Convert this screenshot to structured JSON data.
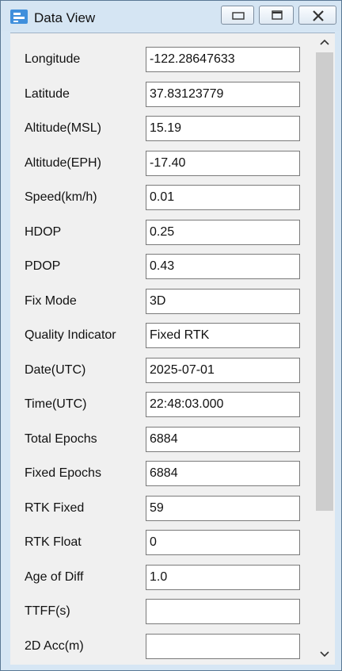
{
  "window": {
    "title": "Data View",
    "buttons": [
      "minimize",
      "restore",
      "close"
    ]
  },
  "rows": [
    {
      "label": "Longitude",
      "value": "-122.28647633"
    },
    {
      "label": "Latitude",
      "value": "37.83123779"
    },
    {
      "label": "Altitude(MSL)",
      "value": "15.19"
    },
    {
      "label": "Altitude(EPH)",
      "value": "-17.40"
    },
    {
      "label": "Speed(km/h)",
      "value": "0.01"
    },
    {
      "label": "HDOP",
      "value": "0.25"
    },
    {
      "label": "PDOP",
      "value": "0.43"
    },
    {
      "label": "Fix Mode",
      "value": "3D"
    },
    {
      "label": "Quality Indicator",
      "value": "Fixed RTK"
    },
    {
      "label": "Date(UTC)",
      "value": "2025-07-01"
    },
    {
      "label": "Time(UTC)",
      "value": "22:48:03.000"
    },
    {
      "label": "Total Epochs",
      "value": "6884"
    },
    {
      "label": "Fixed Epochs",
      "value": "6884"
    },
    {
      "label": "RTK Fixed",
      "value": "59"
    },
    {
      "label": "RTK Float",
      "value": "0"
    },
    {
      "label": "Age of Diff",
      "value": "1.0"
    },
    {
      "label": "TTFF(s)",
      "value": ""
    },
    {
      "label": "2D Acc(m)",
      "value": ""
    }
  ],
  "colors": {
    "titlebar": "#d5e5f3",
    "window_border": "#5a7894",
    "client": "#f0f0f0",
    "scroll_thumb": "#cdcdcd"
  }
}
